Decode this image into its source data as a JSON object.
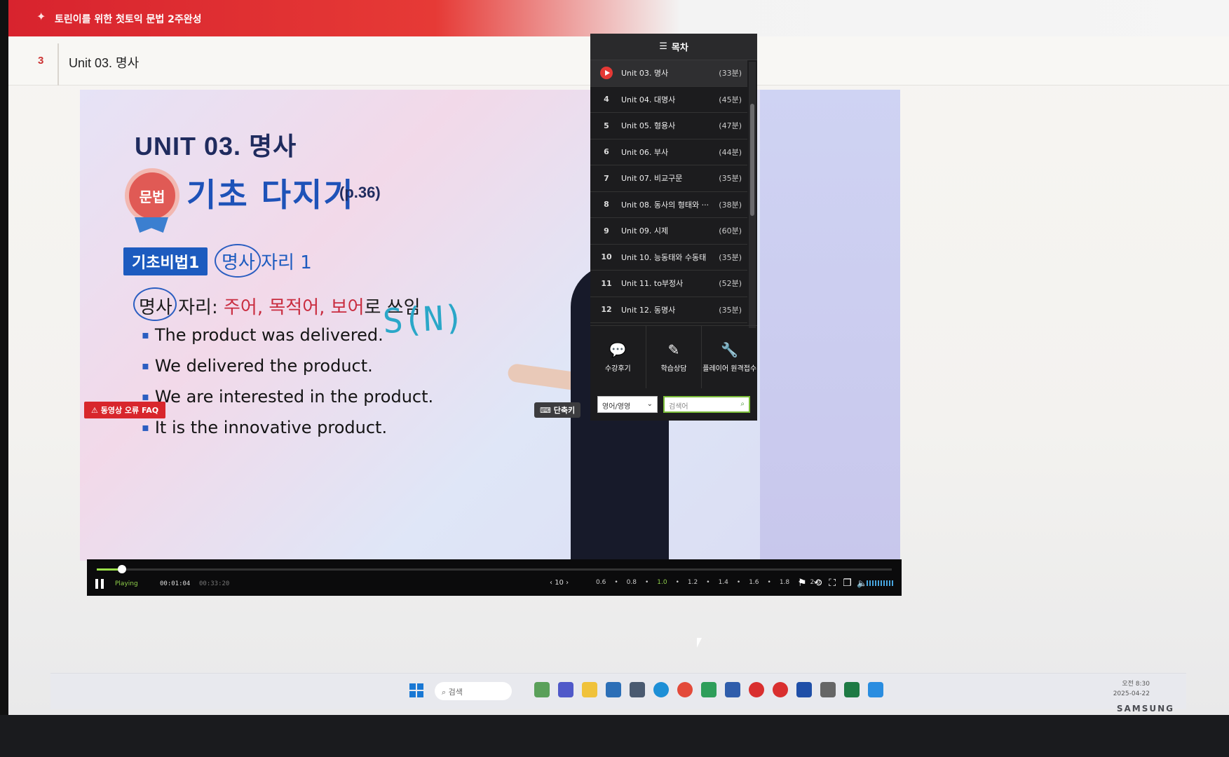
{
  "header": {
    "course_title": "토린이를 위한 첫토익 문법 2주완성",
    "lesson_number": "3",
    "lesson_title": "Unit 03. 명사"
  },
  "slide": {
    "unit_title": "UNIT 03. 명사",
    "badge": "문법",
    "heading": "기초 다지기",
    "page_ref": "(p.36)",
    "tip_label": "기초비법1",
    "tip_text": "명사 자리 1",
    "rule_prefix": "명사 자리: ",
    "rule_subject": "주어",
    "rule_sep1": ", ",
    "rule_object": "목적어",
    "rule_sep2": ", ",
    "rule_complement": "보어",
    "rule_suffix": "로 쓰임",
    "bullets": [
      "The product was delivered.",
      "We delivered the product.",
      "We are interested in the product.",
      "It is the innovative product."
    ],
    "handwriting": "S(N)",
    "faq_button": "동영상 오류 FAQ",
    "shortcut_button": "단축키"
  },
  "toc": {
    "title": "목차",
    "items": [
      {
        "num": "",
        "label": "Unit 03. 명사",
        "duration": "(33분)",
        "active": true
      },
      {
        "num": "4",
        "label": "Unit 04. 대명사",
        "duration": "(45분)"
      },
      {
        "num": "5",
        "label": "Unit 05. 형용사",
        "duration": "(47분)"
      },
      {
        "num": "6",
        "label": "Unit 06. 부사",
        "duration": "(44분)"
      },
      {
        "num": "7",
        "label": "Unit 07. 비교구문",
        "duration": "(35분)"
      },
      {
        "num": "8",
        "label": "Unit 08. 동사의 형태와 ···",
        "duration": "(38분)"
      },
      {
        "num": "9",
        "label": "Unit 09. 시제",
        "duration": "(60분)"
      },
      {
        "num": "10",
        "label": "Unit 10. 능동태와 수동태",
        "duration": "(35분)"
      },
      {
        "num": "11",
        "label": "Unit 11. to부정사",
        "duration": "(52분)"
      },
      {
        "num": "12",
        "label": "Unit 12. 동명사",
        "duration": "(35분)"
      }
    ],
    "actions": {
      "review": "수강후기",
      "consult": "학습상담",
      "remote": "플레이어 원격접수"
    },
    "search": {
      "language_value": "영어/영영",
      "placeholder": "검색어"
    }
  },
  "player": {
    "status": "Playing",
    "current_time": "00:01:04",
    "total_time": "00:33:20",
    "skip_seconds": "10",
    "speeds": [
      "0.6",
      "0.8",
      "1.0",
      "1.2",
      "1.4",
      "1.6",
      "1.8",
      "2.0"
    ],
    "selected_speed": "1.0",
    "progress_fraction": 0.032
  },
  "taskbar": {
    "search_placeholder": "검색",
    "clock_time": "오전 8:30",
    "clock_date": "2025-04-22"
  },
  "monitor": {
    "brand": "SAMSUNG"
  },
  "colors": {
    "brand_red": "#d8232e",
    "toc_bg": "#1c1c1e",
    "accent_green": "#8fcf4a",
    "slide_blue": "#1e52b8"
  }
}
